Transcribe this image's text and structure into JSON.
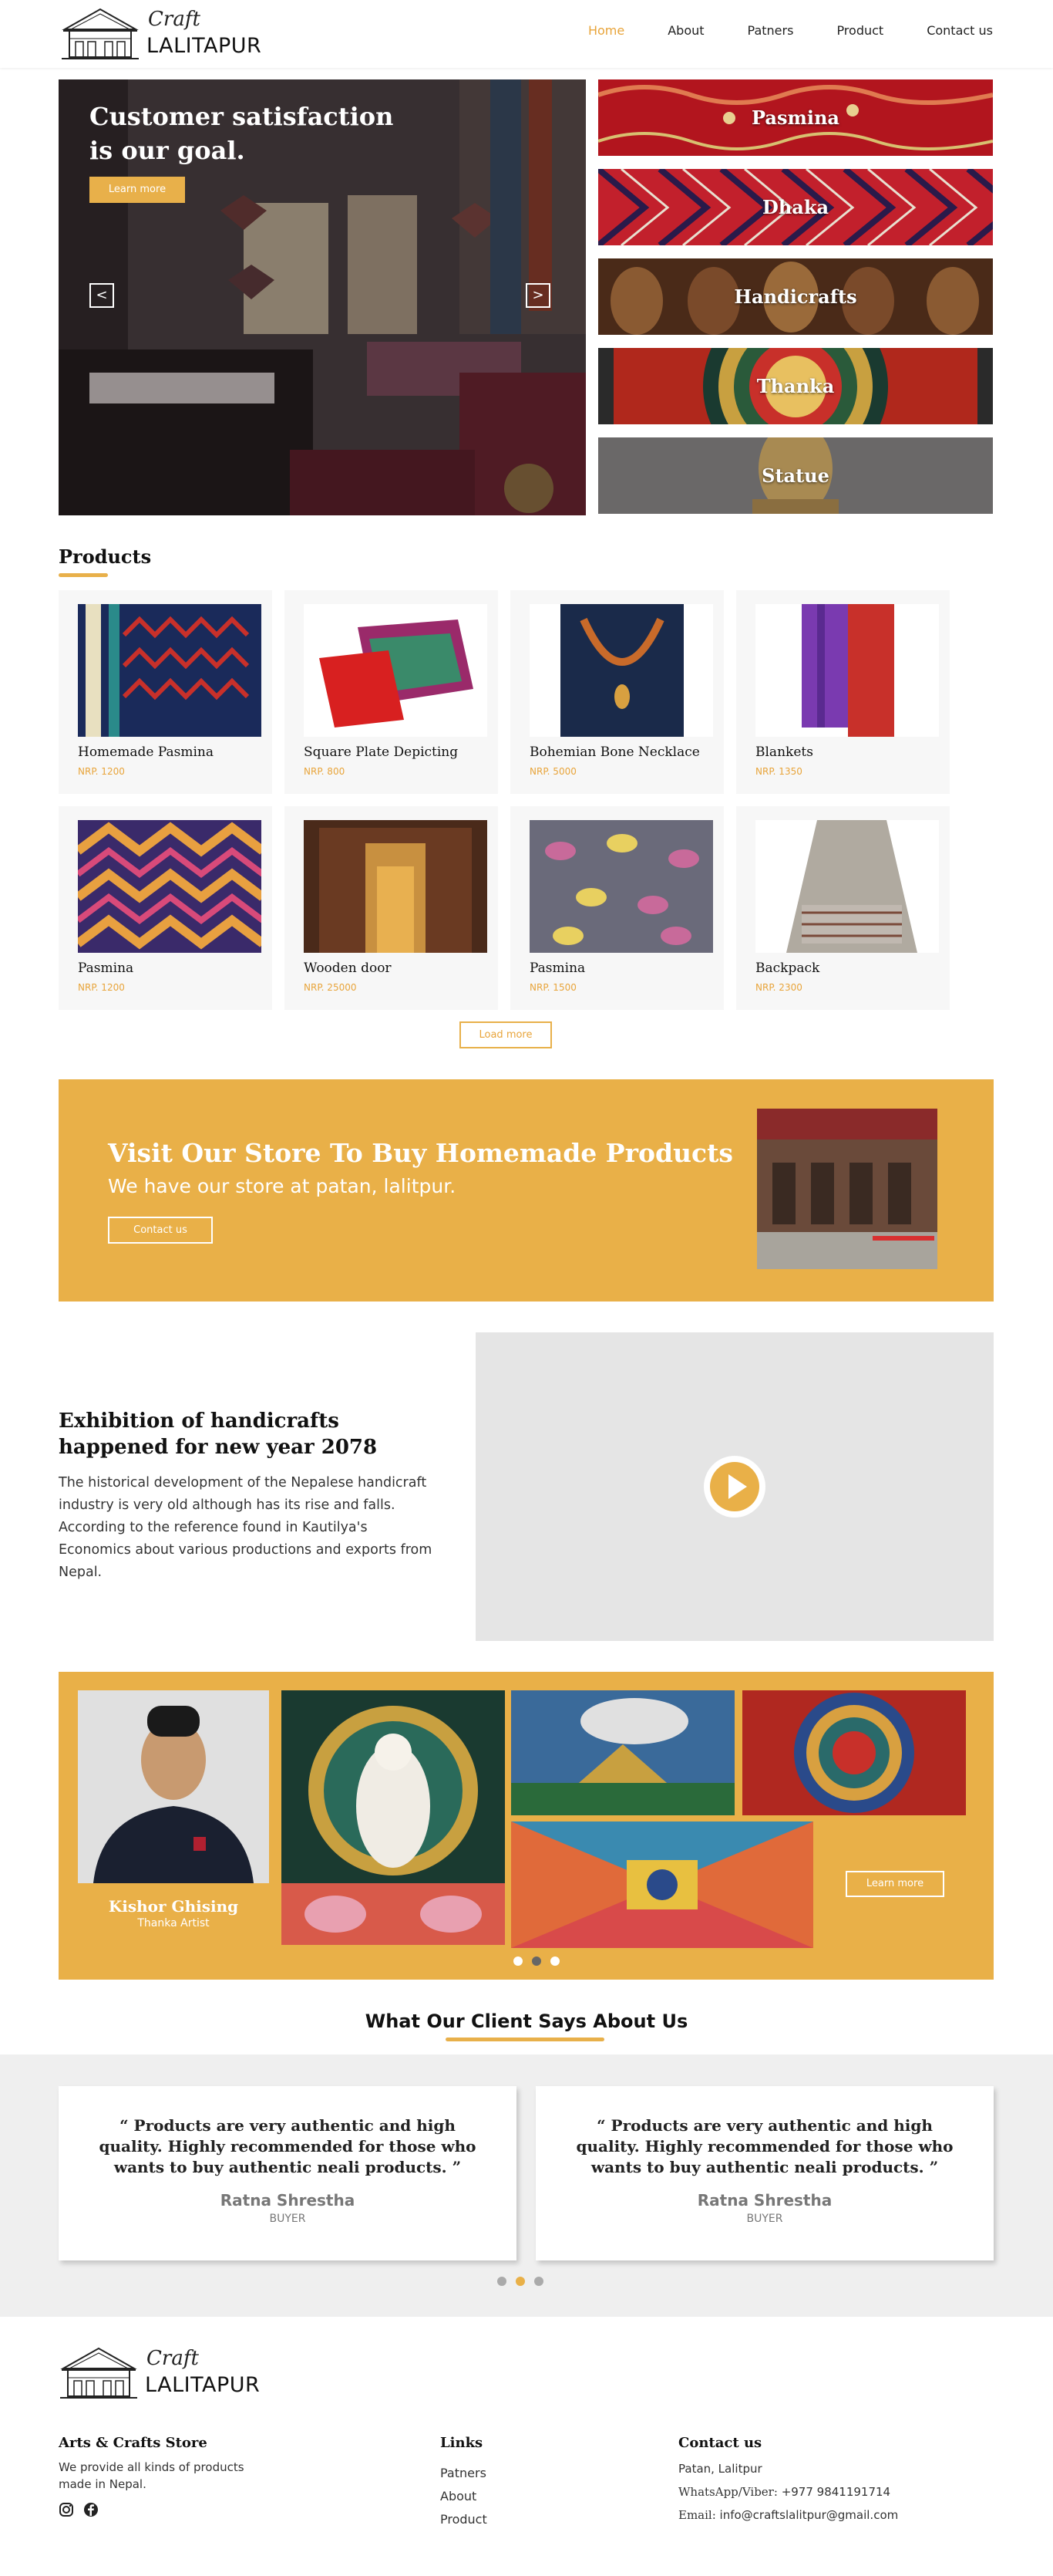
{
  "header": {
    "logo_script": "Craft",
    "logo_name": "LALITAPUR",
    "nav": [
      "Home",
      "About",
      "Patners",
      "Product",
      "Contact us"
    ]
  },
  "hero": {
    "title": "Customer satisfaction is our goal.",
    "button": "Learn more",
    "prev": "<",
    "next": ">"
  },
  "categories": [
    "Pasmina",
    "Dhaka",
    "Handicrafts",
    "Thanka",
    "Statue"
  ],
  "products": {
    "title": "Products",
    "items": [
      {
        "name": "Homemade Pasmina",
        "price": "NRP. 1200"
      },
      {
        "name": "Square Plate Depicting",
        "price": "NRP. 800"
      },
      {
        "name": "Bohemian Bone Necklace",
        "price": "NRP. 5000"
      },
      {
        "name": "Blankets",
        "price": "NRP. 1350"
      },
      {
        "name": "Pasmina",
        "price": "NRP. 1200"
      },
      {
        "name": "Wooden door",
        "price": "NRP. 25000"
      },
      {
        "name": "Pasmina",
        "price": "NRP. 1500"
      },
      {
        "name": "Backpack",
        "price": "NRP. 2300"
      }
    ],
    "load_more": "Load more"
  },
  "store": {
    "title": "Visit Our Store To Buy Homemade Products",
    "subtitle": "We have our store at patan, lalitpur.",
    "button": "Contact us"
  },
  "exhibition": {
    "title": "Exhibition of handicrafts happened for new year 2078",
    "text": "The historical development of the Nepalese handicraft industry is very old although has its rise and falls. According to the reference found in Kautilya's Economics about various productions and exports from Nepal."
  },
  "artist": {
    "name": "Kishor Ghising",
    "role": "Thanka Artist",
    "button": "Learn more"
  },
  "testimonials": {
    "title": "What Our Client Says About Us",
    "items": [
      {
        "quote": "“ Products are very authentic and high quality. Highly recommended for those who wants to buy authentic neali products. ”",
        "name": "Ratna Shrestha",
        "role": "BUYER"
      },
      {
        "quote": "“ Products are very authentic and high quality. Highly recommended for those who wants to buy authentic neali products. ”",
        "name": "Ratna Shrestha",
        "role": "BUYER"
      }
    ]
  },
  "footer": {
    "logo_script": "Craft",
    "logo_name": "LALITAPUR",
    "about_title": "Arts & Crafts Store",
    "about_text": "We provide all kinds of products made in Nepal.",
    "links_title": "Links",
    "links": [
      "Patners",
      "About",
      "Product"
    ],
    "contact_title": "Contact us",
    "address": "Patan, Lalitpur",
    "phone_label": "WhatsApp/Viber:",
    "phone": "+977 9841191714",
    "email_label": "Email:",
    "email": "info@craftslalitpur@gmail.com"
  },
  "colors": {
    "accent": "#e9b048",
    "text": "#222222",
    "panel": "#efefef"
  }
}
